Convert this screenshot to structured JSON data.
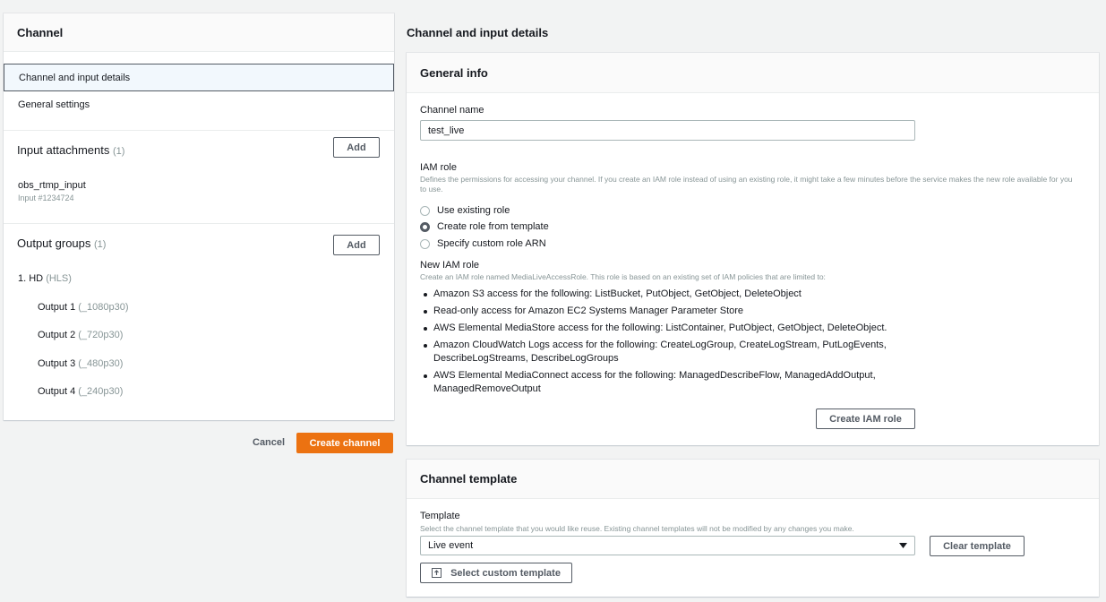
{
  "left": {
    "title": "Channel",
    "nav": [
      "Channel and input details",
      "General settings"
    ],
    "input_attachments": {
      "title": "Input attachments",
      "count": "(1)",
      "add_label": "Add",
      "item_name": "obs_rtmp_input",
      "item_sub": "Input #1234724"
    },
    "output_groups": {
      "title": "Output groups",
      "count": "(1)",
      "add_label": "Add",
      "group_name": "1. HD",
      "group_type": "(HLS)",
      "outputs": [
        {
          "name": "Output 1",
          "suffix": "(_1080p30)"
        },
        {
          "name": "Output 2",
          "suffix": "(_720p30)"
        },
        {
          "name": "Output 3",
          "suffix": "(_480p30)"
        },
        {
          "name": "Output 4",
          "suffix": "(_240p30)"
        }
      ]
    },
    "cancel_label": "Cancel",
    "create_label": "Create channel"
  },
  "right": {
    "page_title": "Channel and input details",
    "general_info": {
      "title": "General info",
      "channel_name_label": "Channel name",
      "channel_name_value": "test_live",
      "iam_role_label": "IAM role",
      "iam_role_desc": "Defines the permissions for accessing your channel. If you create an IAM role instead of using an existing role, it might take a few minutes before the service makes the new role available for you to use.",
      "radios": [
        "Use existing role",
        "Create role from template",
        "Specify custom role ARN"
      ],
      "selected_radio": 1,
      "new_iam_label": "New IAM role",
      "new_iam_desc": "Create an IAM role named MediaLiveAccessRole. This role is based on an existing set of IAM policies that are limited to:",
      "bullets": [
        "Amazon S3 access for the following: ListBucket, PutObject, GetObject, DeleteObject",
        "Read-only access for Amazon EC2 Systems Manager Parameter Store",
        "AWS Elemental MediaStore access for the following: ListContainer, PutObject, GetObject, DeleteObject.",
        "Amazon CloudWatch Logs access for the following: CreateLogGroup, CreateLogStream, PutLogEvents, DescribeLogStreams, DescribeLogGroups",
        "AWS Elemental MediaConnect access for the following: ManagedDescribeFlow, ManagedAddOutput, ManagedRemoveOutput"
      ],
      "create_iam_label": "Create IAM role"
    },
    "channel_template": {
      "title": "Channel template",
      "template_label": "Template",
      "template_desc": "Select the channel template that you would like reuse. Existing channel templates will not be modified by any changes you make.",
      "template_value": "Live event",
      "clear_label": "Clear template",
      "custom_label": "Select custom template"
    }
  },
  "icons": {
    "dropdown": "caret-down-icon",
    "upload": "upload-icon"
  },
  "colors": {
    "primary": "#ec7211",
    "selected_border": "#545b64"
  }
}
